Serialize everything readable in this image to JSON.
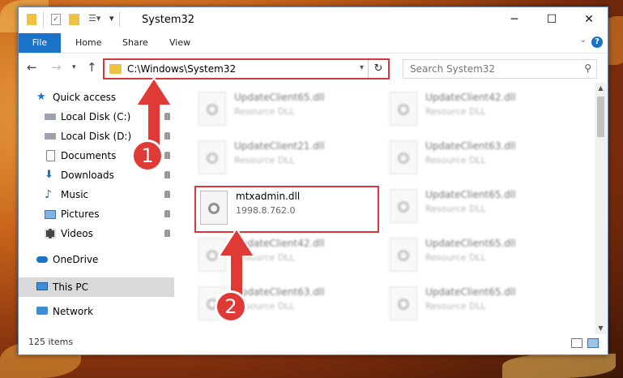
{
  "window": {
    "title": "System32",
    "controls": {
      "minimize": "─",
      "maximize": "☐",
      "close": "✕"
    }
  },
  "ribbon": {
    "tabs": [
      "File",
      "Home",
      "Share",
      "View"
    ],
    "help": "?"
  },
  "address": {
    "path": "C:\\Windows\\System32",
    "refresh": "↻"
  },
  "search": {
    "placeholder": "Search System32"
  },
  "sidebar": {
    "items": [
      {
        "label": "Quick access",
        "icon": "star-icon"
      },
      {
        "label": "Local Disk (C:)",
        "icon": "drive-icon"
      },
      {
        "label": "Local Disk (D:)",
        "icon": "drive-icon"
      },
      {
        "label": "Documents",
        "icon": "document-icon"
      },
      {
        "label": "Downloads",
        "icon": "download-icon"
      },
      {
        "label": "Music",
        "icon": "music-icon"
      },
      {
        "label": "Pictures",
        "icon": "picture-icon"
      },
      {
        "label": "Videos",
        "icon": "video-icon"
      },
      {
        "label": "OneDrive",
        "icon": "cloud-icon"
      },
      {
        "label": "This PC",
        "icon": "computer-icon"
      },
      {
        "label": "Network",
        "icon": "network-icon"
      }
    ]
  },
  "files": {
    "selected": {
      "name": "mtxadmin.dll",
      "desc": "1998.8.762.0"
    },
    "left": [
      {
        "name": "UpdateClient65.dll",
        "desc": "Resource DLL"
      },
      {
        "name": "UpdateClient21.dll",
        "desc": "Resource DLL"
      },
      {
        "name": "UpdateClient42.dll",
        "desc": "Resource DLL"
      },
      {
        "name": "UpdateClient63.dll",
        "desc": "Resource DLL"
      }
    ],
    "right": [
      {
        "name": "UpdateClient42.dll",
        "desc": "Resource DLL"
      },
      {
        "name": "UpdateClient63.dll",
        "desc": "Resource DLL"
      },
      {
        "name": "UpdateClient65.dll",
        "desc": "Resource DLL"
      },
      {
        "name": "UpdateClient65.dll",
        "desc": "Resource DLL"
      },
      {
        "name": "UpdateClient65.dll",
        "desc": "Resource DLL"
      }
    ]
  },
  "status": {
    "count": "125 items"
  },
  "callouts": {
    "one": "1",
    "two": "2"
  },
  "colors": {
    "accent": "#1a73c8",
    "highlight": "#d9383a"
  }
}
